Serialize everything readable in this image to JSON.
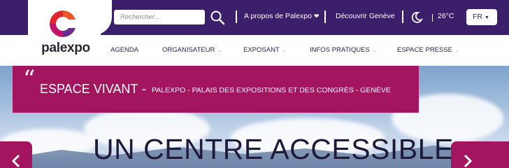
{
  "brand": {
    "name": "palexpo"
  },
  "search": {
    "placeholder": "Rechercher..."
  },
  "top_links": {
    "about": "A propos de Palexpo",
    "discover": "Découvrir Genève"
  },
  "weather": {
    "temperature": "26°C",
    "icon": "weather-icon"
  },
  "language": {
    "selected": "FR"
  },
  "nav": {
    "items": [
      {
        "label": "AGENDA",
        "has_dropdown": false
      },
      {
        "label": "ORGANISATEUR",
        "has_dropdown": true
      },
      {
        "label": "EXPOSANT",
        "has_dropdown": true
      },
      {
        "label": "INFOS PRATIQUES",
        "has_dropdown": true
      },
      {
        "label": "ESPACE PRESSE",
        "has_dropdown": true
      }
    ]
  },
  "hero": {
    "quote_mark": "“",
    "banner_title": "ESPACE VIVANT",
    "banner_dash": "-",
    "banner_subtitle": "PALEXPO - PALAIS DES EXPOSITIONS ET DES CONGRÈS - GENÈVE",
    "headline": "UN CENTRE ACCESSIBLE"
  },
  "colors": {
    "topbar": "#3b1f6b",
    "accent": "#a3155f",
    "logo_red": "#e2262e",
    "logo_magenta": "#c01569",
    "logo_purple": "#3b1f6b"
  }
}
